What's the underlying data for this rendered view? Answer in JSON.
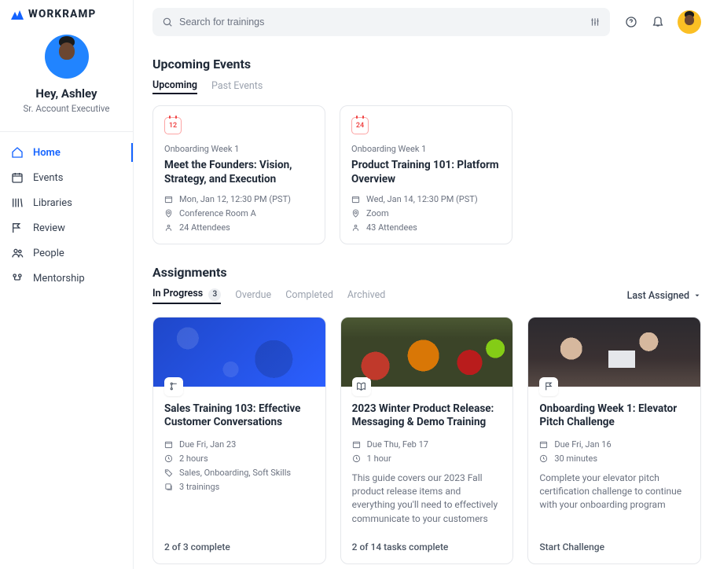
{
  "brand": "WORKRAMP",
  "user": {
    "greeting": "Hey, Ashley",
    "role": "Sr. Account Executive"
  },
  "search": {
    "placeholder": "Search for trainings"
  },
  "nav": [
    {
      "label": "Home",
      "icon": "home-icon",
      "active": true
    },
    {
      "label": "Events",
      "icon": "calendar-icon",
      "active": false
    },
    {
      "label": "Libraries",
      "icon": "library-icon",
      "active": false
    },
    {
      "label": "Review",
      "icon": "flag-icon",
      "active": false
    },
    {
      "label": "People",
      "icon": "people-icon",
      "active": false
    },
    {
      "label": "Mentorship",
      "icon": "mentorship-icon",
      "active": false
    }
  ],
  "events": {
    "heading": "Upcoming Events",
    "tabs": {
      "upcoming": "Upcoming",
      "past": "Past Events"
    },
    "cards": [
      {
        "day": "12",
        "label": "Onboarding Week 1",
        "title": "Meet the Founders: Vision, Strategy, and Execution",
        "time": "Mon, Jan 12, 12:30 PM (PST)",
        "location": "Conference Room A",
        "attendees": "24 Attendees"
      },
      {
        "day": "24",
        "label": "Onboarding Week 1",
        "title": "Product Training 101: Platform Overview",
        "time": "Wed, Jan 14, 12:30 PM (PST)",
        "location": "Zoom",
        "attendees": "43 Attendees"
      }
    ]
  },
  "assignments": {
    "heading": "Assignments",
    "tabs": {
      "in_progress": "In Progress",
      "in_progress_count": "3",
      "overdue": "Overdue",
      "completed": "Completed",
      "archived": "Archived"
    },
    "sort_label": "Last Assigned",
    "cards": [
      {
        "title": "Sales Training 103: Effective Customer Conversations",
        "due": "Due Fri, Jan 23",
        "duration": "2 hours",
        "tags": "Sales, Onboarding, Soft Skills",
        "subcount": "3 trainings",
        "footer": "2 of 3 complete"
      },
      {
        "title": "2023 Winter Product Release: Messaging & Demo Training",
        "due": "Due Thu, Feb 17",
        "duration": "1 hour",
        "desc": "This guide covers our 2023 Fall product release items and everything you'll need to effectively communicate to your customers",
        "footer": "2 of 14 tasks complete"
      },
      {
        "title": "Onboarding Week 1: Elevator Pitch Challenge",
        "due": "Due Fri, Jan 16",
        "duration": "30 minutes",
        "desc": "Complete your elevator pitch certification challenge to continue with your onboarding program",
        "footer": "Start Challenge"
      }
    ]
  }
}
